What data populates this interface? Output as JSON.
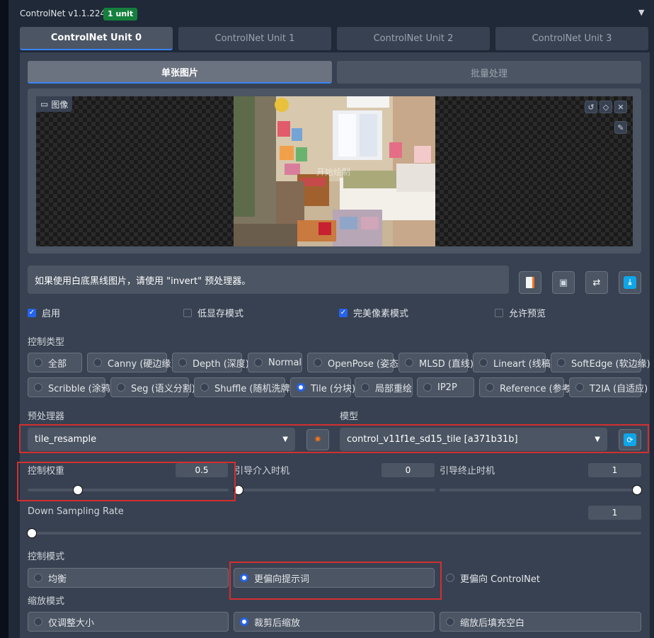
{
  "header": {
    "title": "ControlNet v1.1.224",
    "badge": "1 unit"
  },
  "unit_tabs": [
    "ControlNet Unit 0",
    "ControlNet Unit 1",
    "ControlNet Unit 2",
    "ControlNet Unit 3"
  ],
  "image_tabs": [
    "单张图片",
    "批量处理"
  ],
  "image": {
    "label": "图像",
    "overlay_text": "开始绘制"
  },
  "hint": "如果使用白底黑线图片，请使用 \"invert\" 预处理器。",
  "checkboxes": [
    {
      "label": "启用",
      "checked": true
    },
    {
      "label": "低显存模式",
      "checked": false
    },
    {
      "label": "完美像素模式",
      "checked": true
    },
    {
      "label": "允许预览",
      "checked": false
    }
  ],
  "control_type": {
    "title": "控制类型",
    "row1": [
      "全部",
      "Canny (硬边缘)",
      "Depth (深度)",
      "Normal",
      "OpenPose (姿态)",
      "MLSD (直线)",
      "Lineart (线稿)",
      "SoftEdge (软边缘)"
    ],
    "row2": [
      "Scribble (涂鸦)",
      "Seg (语义分割)",
      "Shuffle (随机洗牌)",
      "Tile (分块)",
      "局部重绘",
      "IP2P",
      "Reference (参考)",
      "T2IA (自适应)"
    ],
    "selected": "Tile (分块)"
  },
  "preprocessor": {
    "label": "预处理器",
    "value": "tile_resample"
  },
  "model": {
    "label": "模型",
    "value": "control_v11f1e_sd15_tile [a371b31b]"
  },
  "sliders": {
    "weight": {
      "label": "控制权重",
      "value": "0.5",
      "fraction": 0.25
    },
    "start": {
      "label": "引导介入时机",
      "value": "0",
      "fraction": 0
    },
    "end": {
      "label": "引导终止时机",
      "value": "1",
      "fraction": 1
    },
    "down_sampling": {
      "label": "Down Sampling Rate",
      "value": "1",
      "fraction": 0
    }
  },
  "control_mode": {
    "title": "控制模式",
    "options": [
      "均衡",
      "更偏向提示词",
      "更偏向 ControlNet"
    ],
    "selected": "更偏向提示词"
  },
  "resize_mode": {
    "title": "缩放模式",
    "options": [
      "仅调整大小",
      "裁剪后缩放",
      "缩放后填充空白"
    ],
    "selected": "裁剪后缩放"
  },
  "colors": {
    "accent": "#2563eb",
    "highlight": "#d32f2f",
    "badge": "#15803d"
  }
}
